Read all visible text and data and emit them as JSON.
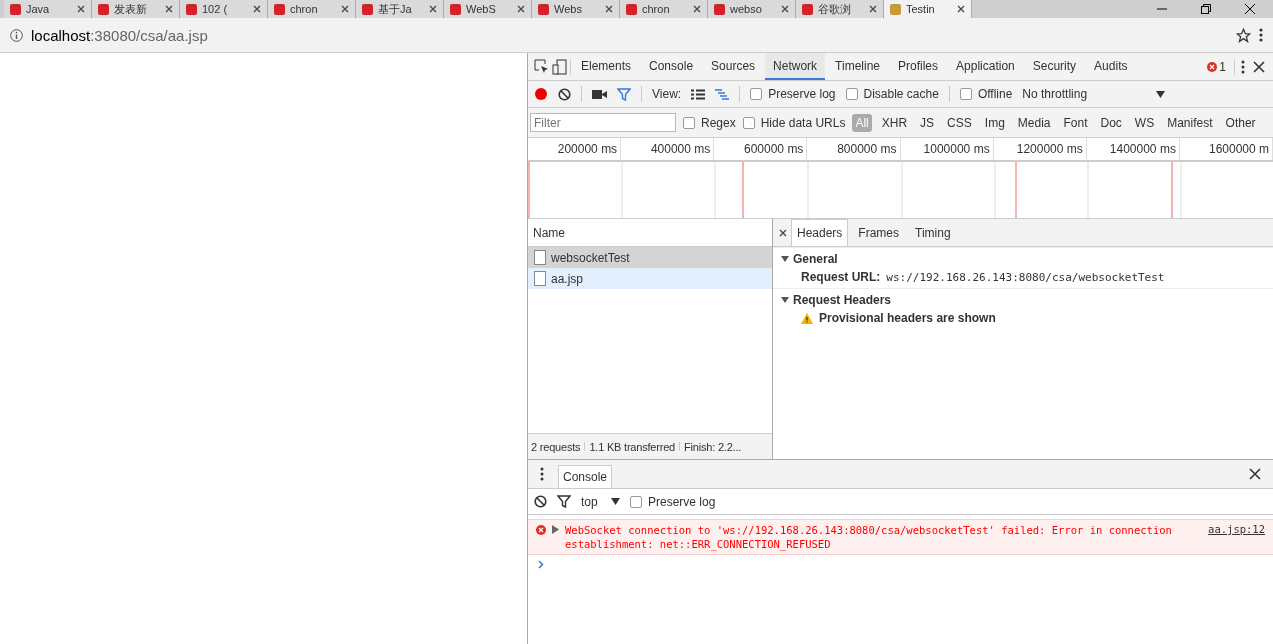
{
  "browser": {
    "tabs": [
      {
        "title": "Java",
        "selected": false
      },
      {
        "title": "发表新",
        "selected": false
      },
      {
        "title": "102 (",
        "selected": false
      },
      {
        "title": "chron",
        "selected": false
      },
      {
        "title": "基于Ja",
        "selected": false
      },
      {
        "title": "WebS",
        "selected": false
      },
      {
        "title": "Webs",
        "selected": false
      },
      {
        "title": "chron",
        "selected": false
      },
      {
        "title": "webso",
        "selected": false
      },
      {
        "title": "谷歌浏",
        "selected": false
      },
      {
        "title": "Testin",
        "selected": true
      }
    ],
    "address": {
      "host": "localhost",
      "path": ":38080/csa/aa.jsp"
    }
  },
  "devtools": {
    "panels": [
      {
        "label": "Elements",
        "selected": false
      },
      {
        "label": "Console",
        "selected": false
      },
      {
        "label": "Sources",
        "selected": false
      },
      {
        "label": "Network",
        "selected": true
      },
      {
        "label": "Timeline",
        "selected": false
      },
      {
        "label": "Profiles",
        "selected": false
      },
      {
        "label": "Application",
        "selected": false
      },
      {
        "label": "Security",
        "selected": false
      },
      {
        "label": "Audits",
        "selected": false
      }
    ],
    "error_count": "1",
    "toolbar": {
      "recording": true,
      "view_label": "View:",
      "options": [
        {
          "label": "Preserve log",
          "checked": false
        },
        {
          "label": "Disable cache",
          "checked": false
        },
        {
          "label": "Offline",
          "checked": false
        }
      ],
      "throttling": "No throttling"
    },
    "filter": {
      "placeholder": "Filter",
      "options": [
        {
          "label": "Regex",
          "checked": false
        },
        {
          "label": "Hide data URLs",
          "checked": false
        }
      ],
      "types": [
        {
          "label": "All",
          "selected": true
        },
        {
          "label": "XHR",
          "selected": false
        },
        {
          "label": "JS",
          "selected": false
        },
        {
          "label": "CSS",
          "selected": false
        },
        {
          "label": "Img",
          "selected": false
        },
        {
          "label": "Media",
          "selected": false
        },
        {
          "label": "Font",
          "selected": false
        },
        {
          "label": "Doc",
          "selected": false
        },
        {
          "label": "WS",
          "selected": false
        },
        {
          "label": "Manifest",
          "selected": false
        },
        {
          "label": "Other",
          "selected": false
        }
      ]
    },
    "timeline": {
      "tick_labels": [
        "200000 ms",
        "400000 ms",
        "600000 ms",
        "800000 ms",
        "1000000 ms",
        "1200000 ms",
        "1400000 ms",
        "1600000 m"
      ]
    },
    "requests": {
      "column": "Name",
      "rows": [
        {
          "name": "websocketTest",
          "selected": true
        },
        {
          "name": "aa.jsp",
          "selected": false
        }
      ],
      "summary": [
        "2 requests",
        "1.1 KB transferred",
        "Finish: 2.2..."
      ]
    },
    "details": {
      "tabs": [
        {
          "label": "Headers",
          "selected": true
        },
        {
          "label": "Frames",
          "selected": false
        },
        {
          "label": "Timing",
          "selected": false
        }
      ],
      "sections": [
        {
          "title": "General",
          "expanded": true,
          "rows": [
            {
              "kind": "pair",
              "key": "Request URL:",
              "value": "ws://192.168.26.143:8080/csa/websocketTest"
            }
          ]
        },
        {
          "title": "Request Headers",
          "expanded": true,
          "rows": [
            {
              "kind": "warning",
              "text": "Provisional headers are shown"
            }
          ]
        }
      ]
    },
    "drawer": {
      "tabs": [
        {
          "label": "Console",
          "selected": true
        }
      ],
      "context": "top",
      "preserve_log": {
        "label": "Preserve log",
        "checked": false
      },
      "messages": [
        {
          "kind": "error",
          "text": "WebSocket connection to 'ws://192.168.26.143:8080/csa/websocketTest' failed: Error in connection establishment: net::ERR_CONNECTION_REFUSED",
          "source": "aa.jsp:12"
        }
      ]
    }
  }
}
